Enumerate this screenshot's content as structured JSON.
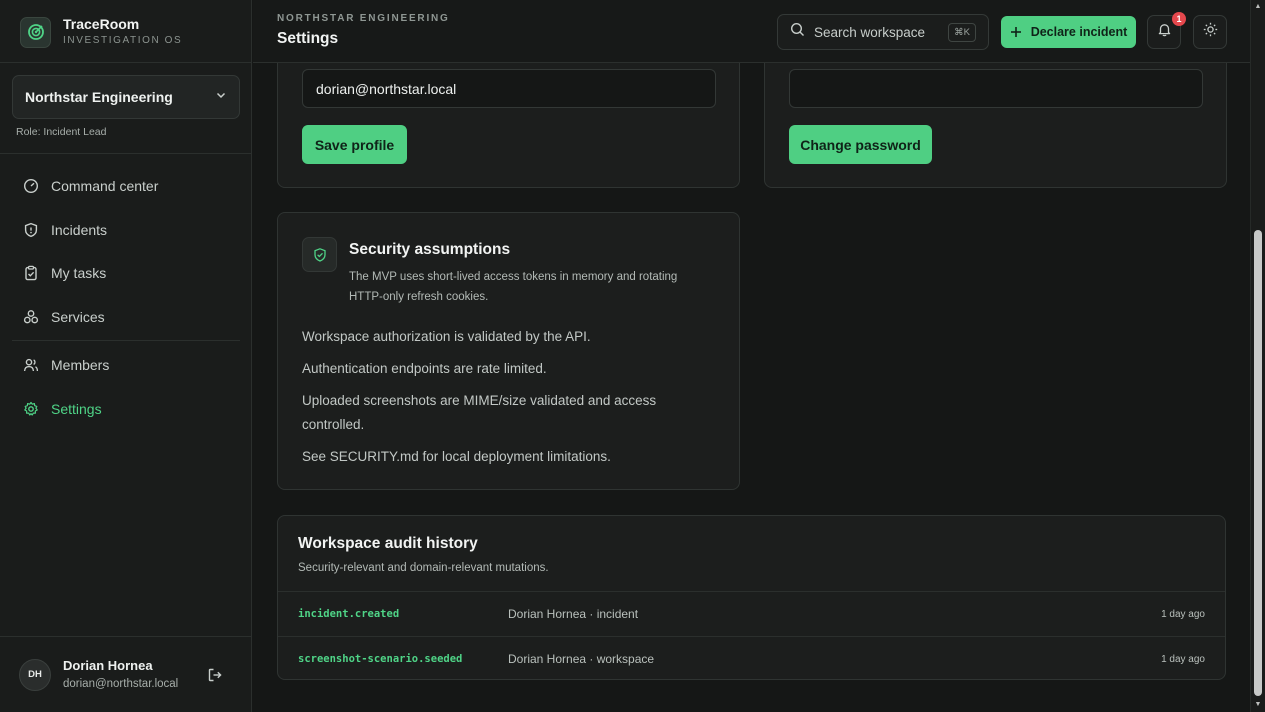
{
  "app": {
    "name": "TraceRoom",
    "subtitle": "INVESTIGATION OS"
  },
  "workspace": {
    "name": "Northstar Engineering",
    "role": "Role: Incident Lead"
  },
  "nav": {
    "group1": [
      {
        "label": "Command center",
        "icon": "gauge-icon"
      },
      {
        "label": "Incidents",
        "icon": "shield-icon"
      },
      {
        "label": "My tasks",
        "icon": "clipboard-check-icon"
      },
      {
        "label": "Services",
        "icon": "services-icon"
      }
    ],
    "group2": [
      {
        "label": "Members",
        "icon": "users-icon"
      },
      {
        "label": "Settings",
        "icon": "gear-icon",
        "active": true
      }
    ]
  },
  "user": {
    "initials": "DH",
    "name": "Dorian Hornea",
    "email": "dorian@northstar.local"
  },
  "header": {
    "org": "NORTHSTAR ENGINEERING",
    "title": "Settings",
    "search_placeholder": "Search workspace",
    "search_shortcut": "⌘K",
    "declare_label": "Declare incident",
    "notification_count": "1"
  },
  "profile": {
    "email_value": "dorian@northstar.local",
    "save_label": "Save profile"
  },
  "password": {
    "value": "",
    "change_label": "Change password"
  },
  "security": {
    "title": "Security assumptions",
    "description": "The MVP uses short-lived access tokens in memory and rotating HTTP-only refresh cookies.",
    "items": [
      "Workspace authorization is validated by the API.",
      "Authentication endpoints are rate limited.",
      "Uploaded screenshots are MIME/size validated and access controlled.",
      "See SECURITY.md for local deployment limitations."
    ]
  },
  "audit": {
    "title": "Workspace audit history",
    "subtitle": "Security-relevant and domain-relevant mutations.",
    "rows": [
      {
        "event": "incident.created",
        "actor": "Dorian Hornea · incident",
        "time": "1 day ago"
      },
      {
        "event": "screenshot-scenario.seeded",
        "actor": "Dorian Hornea · workspace",
        "time": "1 day ago"
      }
    ]
  },
  "colors": {
    "accent": "#4fcf83",
    "background": "#151716",
    "card": "#1c1e1d",
    "badge": "#e5484d"
  }
}
